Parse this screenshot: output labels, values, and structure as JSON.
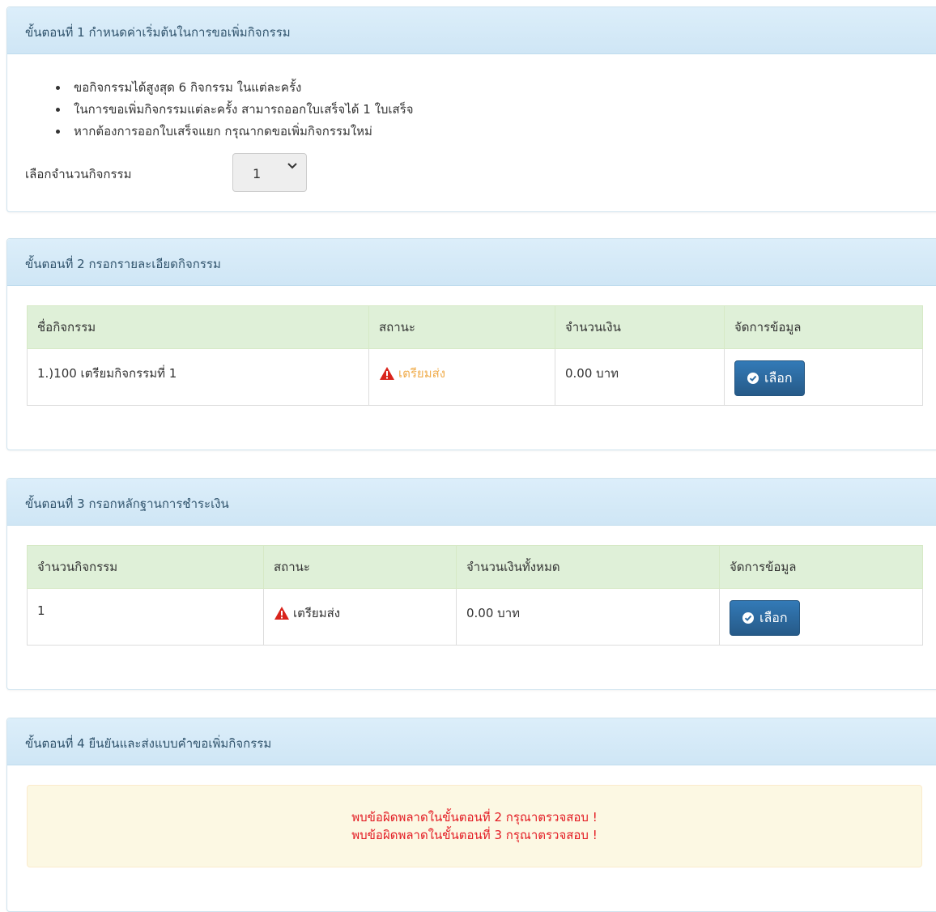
{
  "step1": {
    "title": "ขั้นตอนที่ 1 กำหนดค่าเริ่มต้นในการขอเพิ่มกิจกรรม",
    "rules": [
      "ขอกิจกรรมได้สูงสุด 6 กิจกรรม ในแต่ละครั้ง",
      "ในการขอเพิ่มกิจกรรมแต่ละครั้ง สามารถออกใบเสร็จได้ 1 ใบเสร็จ",
      "หากต้องการออกใบเสร็จแยก กรุณากดขอเพิ่มกิจกรรมใหม่"
    ],
    "select_label": "เลือกจำนวนกิจกรรม",
    "select_value": "1"
  },
  "step2": {
    "title": "ขั้นตอนที่ 2 กรอกรายละเอียดกิจกรรม",
    "headers": [
      "ชื่อกิจกรรม",
      "สถานะ",
      "จำนวนเงิน",
      "จัดการข้อมูล"
    ],
    "rows": [
      {
        "name": "1.)100 เตรียมกิจกรรมที่ 1",
        "status": "เตรียมส่ง",
        "amount": "0.00 บาท",
        "action": "เลือก"
      }
    ]
  },
  "step3": {
    "title": "ขั้นตอนที่ 3 กรอกหลักฐานการชำระเงิน",
    "headers": [
      "จำนวนกิจกรรม",
      "สถานะ",
      "จำนวนเงินทั้งหมด",
      "จัดการข้อมูล"
    ],
    "rows": [
      {
        "count": "1",
        "status": "เตรียมส่ง",
        "amount": "0.00 บาท",
        "action": "เลือก"
      }
    ]
  },
  "step4": {
    "title": "ขั้นตอนที่ 4 ยืนยันและส่งแบบคำขอเพิ่มกิจกรรม",
    "errors": [
      "พบข้อผิดพลาดในขั้นตอนที่ 2 กรุณาตรวจสอบ !",
      "พบข้อผิดพลาดในขั้นตอนที่ 3 กรุณาตรวจสอบ !"
    ]
  },
  "colors": {
    "heading_bg": "#d9edf7",
    "table_header_bg": "#dff0d8",
    "warning_text": "#f0ad4e",
    "warning_icon": "#d9241c",
    "button_bg": "#2e6da4",
    "alert_bg": "#fcf8e3",
    "alert_text": "#e31b23"
  },
  "icons": {
    "status": "warning-triangle-icon",
    "button": "check-circle-icon",
    "select": "chevron-down-icon"
  }
}
